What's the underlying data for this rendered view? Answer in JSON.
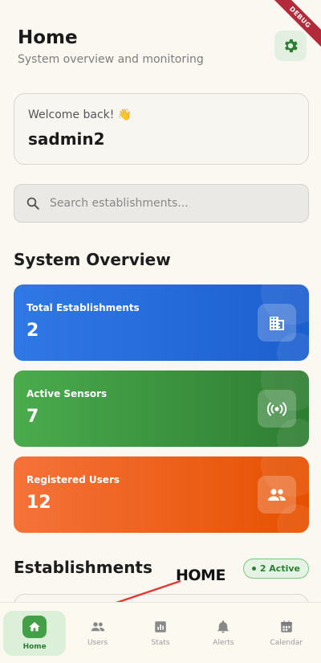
{
  "debug_banner": "DEBUG",
  "header": {
    "title": "Home",
    "subtitle": "System overview and monitoring"
  },
  "welcome": {
    "greeting": "Welcome back! 👋",
    "username": "sadmin2"
  },
  "search": {
    "placeholder": "Search establishments..."
  },
  "overview": {
    "title": "System Overview",
    "cards": [
      {
        "label": "Total Establishments",
        "value": "2",
        "icon": "building-icon",
        "color": "#2f6fe0"
      },
      {
        "label": "Active Sensors",
        "value": "7",
        "icon": "sensor-icon",
        "color": "#3f9a42"
      },
      {
        "label": "Registered Users",
        "value": "12",
        "icon": "users-icon",
        "color": "#f06424"
      }
    ]
  },
  "establishments": {
    "title": "Establishments",
    "badge": "2 Active"
  },
  "annotation": {
    "text": "HOME",
    "color": "#e53935"
  },
  "nav": {
    "items": [
      {
        "label": "Home",
        "icon": "home-icon",
        "active": true
      },
      {
        "label": "Users",
        "icon": "users-icon"
      },
      {
        "label": "Stats",
        "icon": "stats-icon"
      },
      {
        "label": "Alerts",
        "icon": "bell-icon"
      },
      {
        "label": "Calendar",
        "icon": "calendar-icon"
      }
    ]
  },
  "colors": {
    "accent": "#43a047",
    "background": "#fbf8f2"
  }
}
